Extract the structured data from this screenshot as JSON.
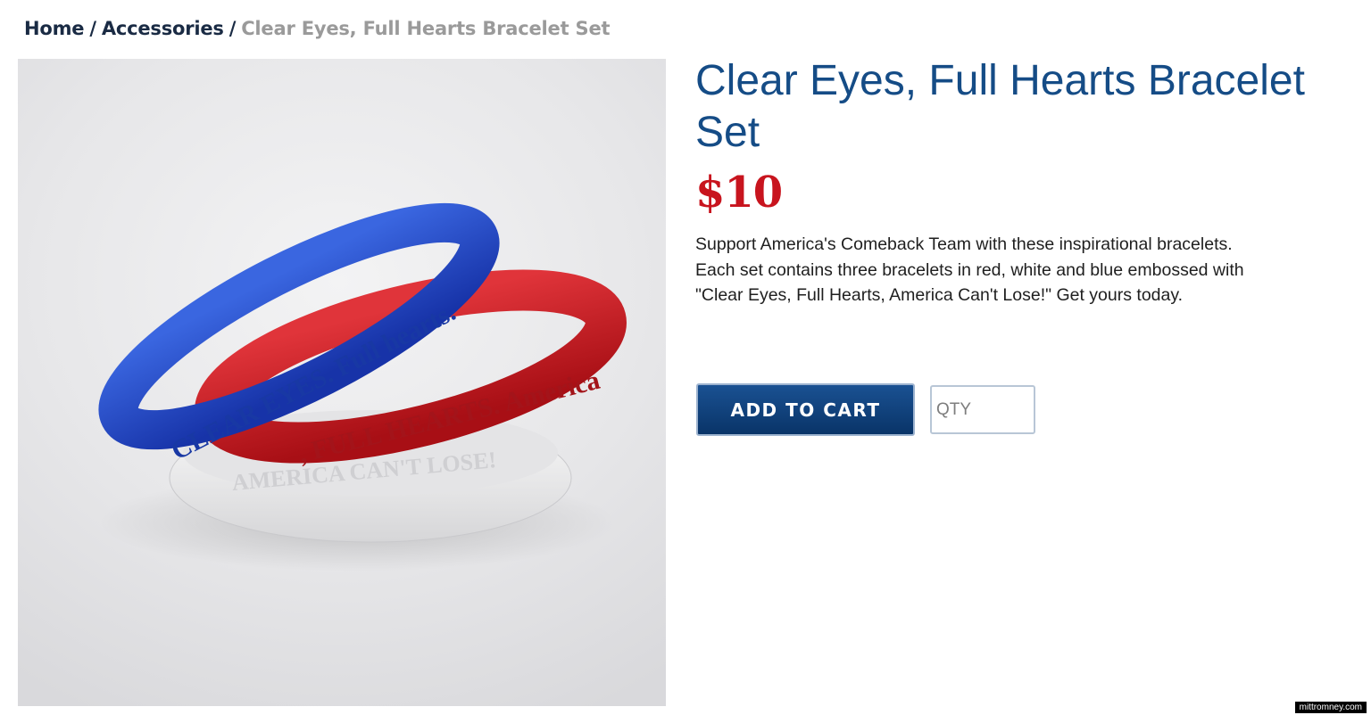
{
  "breadcrumb": {
    "home": "Home",
    "separator": "/",
    "category": "Accessories",
    "current": "Clear Eyes, Full Hearts Bracelet Set"
  },
  "product": {
    "title": "Clear Eyes, Full Hearts Bracelet Set",
    "price": "$10",
    "description": "Support America's Comeback Team with these inspirational bracelets. Each set contains three bracelets in red, white and blue embossed with \"Clear Eyes, Full Hearts, America Can't Lose!\" Get yours today.",
    "image": {
      "blue_band_text": "CLEAR EYES. Full hearts.",
      "red_band_text": ", FULL HEARTS. America",
      "white_band_text": "AMERICA CAN'T LOSE!",
      "colors": {
        "blue": "#1f49c8",
        "red": "#c9161b",
        "white": "#f2f2f2"
      }
    }
  },
  "cart": {
    "add_label": "ADD TO CART",
    "qty_placeholder": "QTY"
  },
  "watermark": "mittromney.com",
  "colors": {
    "title": "#154c86",
    "price": "#c8141e",
    "button": "#0e3c74",
    "breadcrumb": "#1a2b44"
  }
}
